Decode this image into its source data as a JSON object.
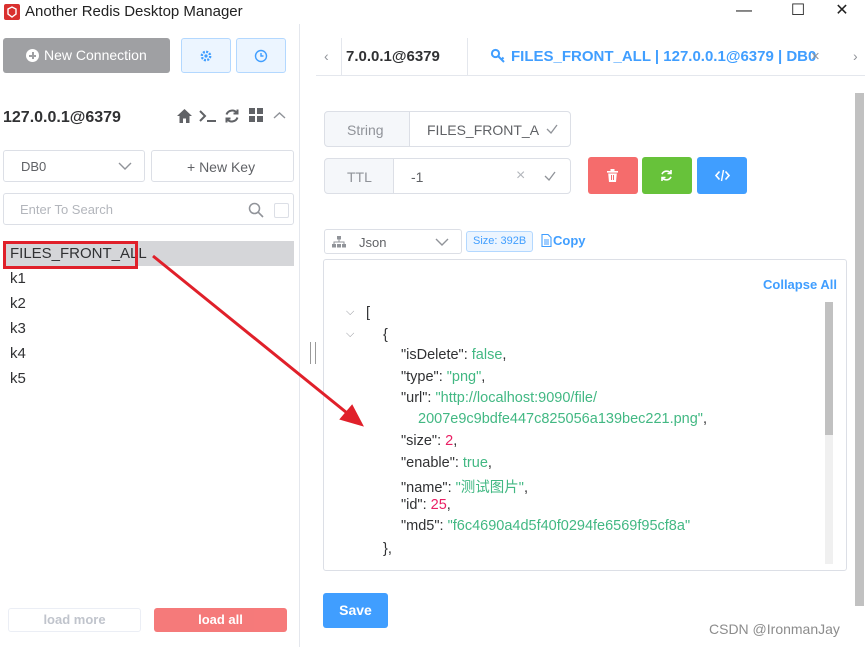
{
  "window": {
    "title": "Another Redis Desktop Manager",
    "controls": {
      "minimize": "—",
      "maximize": "☐",
      "close": "✕"
    }
  },
  "sidebar": {
    "new_connection_label": "New Connection",
    "connection_name": "127.0.0.1@6379",
    "db_select_value": "DB0",
    "new_key_label": "+ New Key",
    "search_placeholder": "Enter To Search",
    "keys": [
      "FILES_FRONT_ALL",
      "k1",
      "k2",
      "k3",
      "k4",
      "k5"
    ],
    "selected_key_index": 0,
    "load_more_label": "load more",
    "load_all_label": "load all"
  },
  "tabs": {
    "nav_left": "‹",
    "nav_right": "›",
    "items": [
      {
        "label": "7.0.0.1@6379"
      },
      {
        "label": "FILES_FRONT_ALL | 127.0.0.1@6379 | DB0",
        "close": "×"
      }
    ]
  },
  "key_view": {
    "type_label": "String",
    "key_name": "FILES_FRONT_ALL",
    "ttl_label": "TTL",
    "ttl_value": "-1",
    "format_value": "Json",
    "size_label": "Size: 392B",
    "copy_label": "Copy",
    "collapse_all_label": "Collapse All",
    "save_label": "Save",
    "json_lines": {
      "open_bracket": "[",
      "open_brace": "{",
      "l1_key": "\"isDelete\"",
      "l1_val": "false",
      "l2_key": "\"type\"",
      "l2_val": "\"png\"",
      "l3_key": "\"url\"",
      "l3_val_a": "\"http://localhost:9090/file/",
      "l3_val_b": "2007e9c9bdfe447c825056a139bec221.png\"",
      "l4_key": "\"size\"",
      "l4_val": "2",
      "l5_key": "\"enable\"",
      "l5_val": "true",
      "l6_key": "\"name\"",
      "l6_val": "\"测试图片\"",
      "l7_key": "\"id\"",
      "l7_val": "25",
      "l8_key": "\"md5\"",
      "l8_val": "\"f6c4690a4d5f40f0294fe6569f95cf8a\"",
      "close_brace": "},"
    }
  },
  "colors": {
    "primary": "#409eff",
    "danger": "#f56c6c",
    "success": "#67c23a",
    "annotation": "#e0202a"
  },
  "watermark": "CSDN @IronmanJay"
}
